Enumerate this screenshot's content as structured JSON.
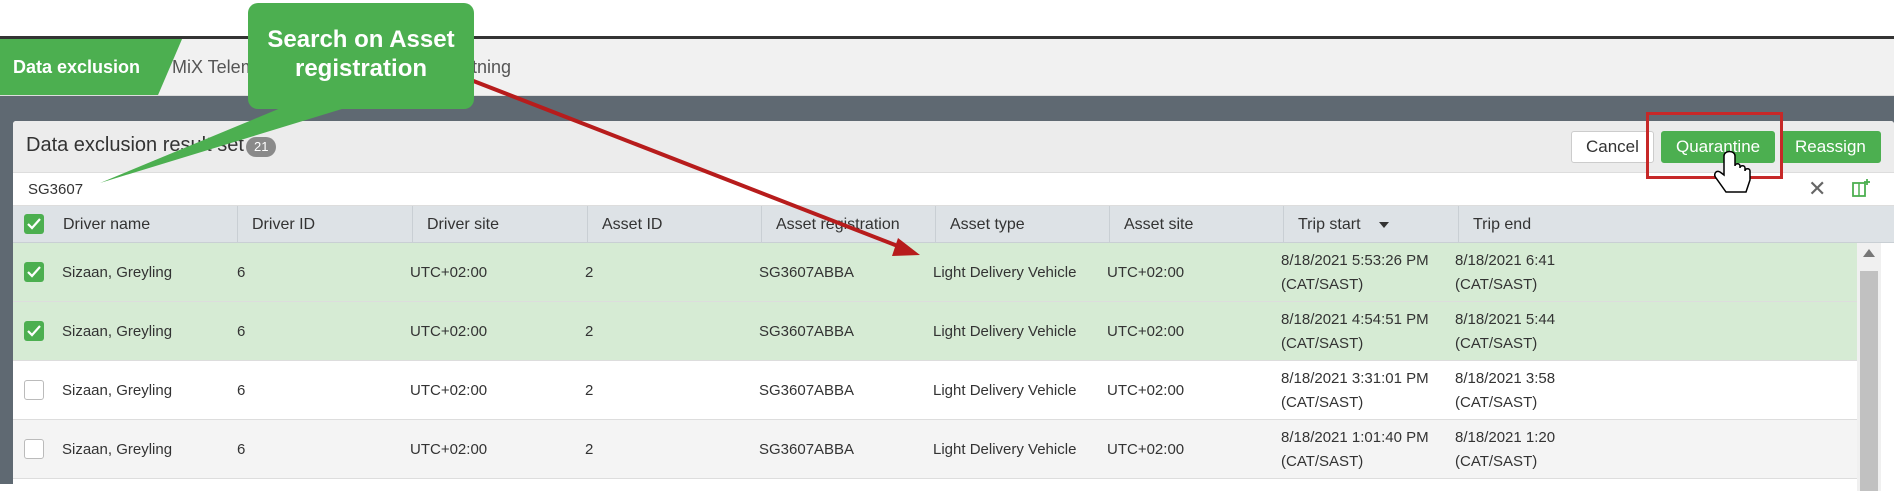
{
  "tabs": [
    {
      "label": "Data exclusion",
      "active": true
    },
    {
      "label": "MiX Telem",
      "active": false
    },
    {
      "label": "tning",
      "active": false
    }
  ],
  "panel": {
    "title": "Data exclusion result set",
    "count": "21",
    "buttons": {
      "cancel": "Cancel",
      "quarantine": "Quarantine",
      "reassign": "Reassign"
    }
  },
  "search": {
    "value": "SG3607",
    "clear_icon": "close-icon",
    "export_icon": "add-column-icon"
  },
  "columns": [
    "Driver name",
    "Driver ID",
    "Driver site",
    "Asset ID",
    "Asset registration",
    "Asset type",
    "Asset site",
    "Trip start",
    "Trip end"
  ],
  "sort": {
    "column": "Trip start",
    "direction": "descending"
  },
  "rows": [
    {
      "selected": true,
      "driver_name": "Sizaan, Greyling",
      "driver_id": "6",
      "driver_site": "UTC+02:00",
      "asset_id": "2",
      "asset_registration": "SG3607ABBA",
      "asset_type": "Light Delivery Vehicle",
      "asset_site": "UTC+02:00",
      "trip_start": "8/18/2021 5:53:26 PM",
      "trip_start_tz": "(CAT/SAST)",
      "trip_end": "8/18/2021 6:41",
      "trip_end_tz": "(CAT/SAST)"
    },
    {
      "selected": true,
      "driver_name": "Sizaan, Greyling",
      "driver_id": "6",
      "driver_site": "UTC+02:00",
      "asset_id": "2",
      "asset_registration": "SG3607ABBA",
      "asset_type": "Light Delivery Vehicle",
      "asset_site": "UTC+02:00",
      "trip_start": "8/18/2021 4:54:51 PM",
      "trip_start_tz": "(CAT/SAST)",
      "trip_end": "8/18/2021 5:44",
      "trip_end_tz": "(CAT/SAST)"
    },
    {
      "selected": false,
      "driver_name": "Sizaan, Greyling",
      "driver_id": "6",
      "driver_site": "UTC+02:00",
      "asset_id": "2",
      "asset_registration": "SG3607ABBA",
      "asset_type": "Light Delivery Vehicle",
      "asset_site": "UTC+02:00",
      "trip_start": "8/18/2021 3:31:01 PM",
      "trip_start_tz": "(CAT/SAST)",
      "trip_end": "8/18/2021 3:58",
      "trip_end_tz": "(CAT/SAST)"
    },
    {
      "selected": false,
      "driver_name": "Sizaan, Greyling",
      "driver_id": "6",
      "driver_site": "UTC+02:00",
      "asset_id": "2",
      "asset_registration": "SG3607ABBA",
      "asset_type": "Light Delivery Vehicle",
      "asset_site": "UTC+02:00",
      "trip_start": "8/18/2021 1:01:40 PM",
      "trip_start_tz": "(CAT/SAST)",
      "trip_end": "8/18/2021 1:20",
      "trip_end_tz": "(CAT/SAST)"
    }
  ],
  "callout": {
    "text": "Search on Asset registration"
  },
  "colors": {
    "accent": "#4caf50",
    "selected_row": "#d6ebd4",
    "annotation": "#c62828",
    "workspace": "#5f6972"
  }
}
